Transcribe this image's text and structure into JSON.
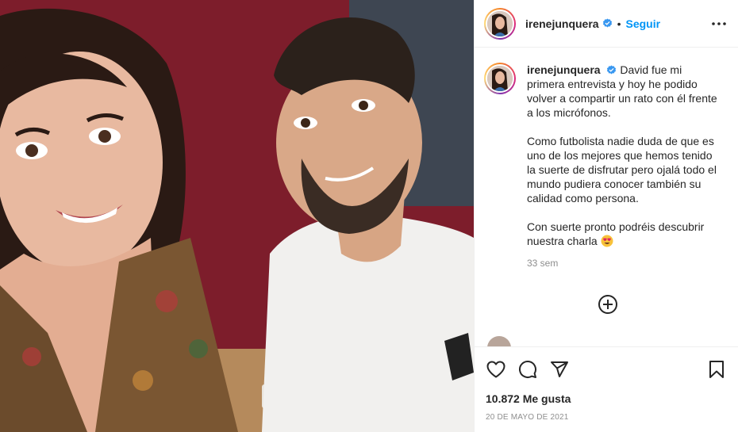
{
  "post": {
    "username": "irenejunquera",
    "separator": "•",
    "follow_label": "Seguir",
    "caption": {
      "username": "irenejunquera",
      "paragraph_1": "David fue mi primera entrevista y hoy he podido volver a compartir un rato con él frente a los micrófonos.",
      "paragraph_2": "Como futbolista nadie duda de que es uno de los mejores que hemos tenido la suerte de disfrutar pero ojalá todo el mundo pudiera conocer también su calidad como persona.",
      "paragraph_3": "Con suerte pronto podréis descubrir nuestra charla"
    },
    "caption_time": "33 sem",
    "likes": "10.872 Me gusta",
    "date": "20 DE MAYO DE 2021"
  },
  "icons": {
    "verified": "verified-badge-icon",
    "more": "more-options-icon",
    "load_more": "plus-circle-icon",
    "like": "heart-icon",
    "comment": "comment-icon",
    "share": "share-icon",
    "save": "bookmark-icon"
  },
  "colors": {
    "accent": "#0095f6",
    "text": "#262626",
    "muted": "#8e8e8e",
    "border": "#efefef",
    "photo_background": "#7a1f2c"
  }
}
